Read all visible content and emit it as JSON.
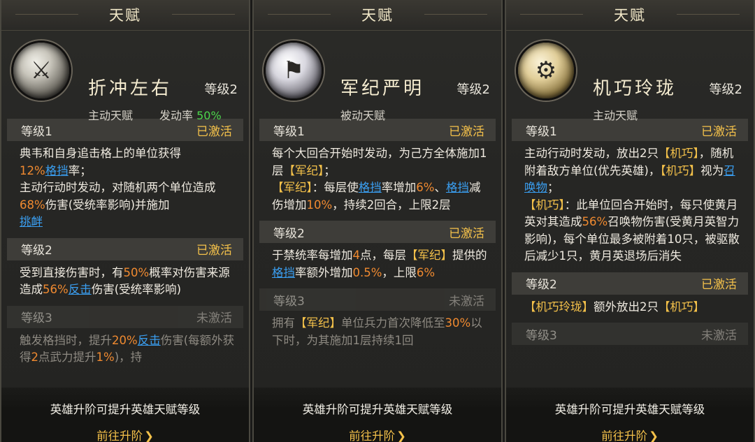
{
  "panels": [
    {
      "title": "天赋",
      "skill_name": "折冲左右",
      "level": "等级2",
      "skill_type": "主动天赋",
      "rate_label": "发动率",
      "rate_value": "50%",
      "icon": "crossed-weapons-icon",
      "sections": [
        {
          "name": "等级1",
          "status": "已激活"
        },
        {
          "name": "等级2",
          "status": "已激活"
        },
        {
          "name": "等级3",
          "status": "未激活"
        }
      ],
      "footer_hint": "英雄升阶可提升英雄天赋等级",
      "footer_link": "前往升阶"
    },
    {
      "title": "天赋",
      "skill_name": "军纪严明",
      "level": "等级2",
      "skill_type": "被动天赋",
      "icon": "flag-banner-icon",
      "sections": [
        {
          "name": "等级1",
          "status": "已激活"
        },
        {
          "name": "等级2",
          "status": "已激活"
        },
        {
          "name": "等级3",
          "status": "未激活"
        }
      ],
      "footer_hint": "英雄升阶可提升英雄天赋等级",
      "footer_link": "前往升阶"
    },
    {
      "title": "天赋",
      "skill_name": "机巧玲珑",
      "level": "等级2",
      "skill_type": "主动天赋",
      "icon": "gear-mechanism-icon",
      "sections": [
        {
          "name": "等级1",
          "status": "已激活"
        },
        {
          "name": "等级2",
          "status": "已激活"
        },
        {
          "name": "等级3",
          "status": "未激活"
        }
      ],
      "footer_hint": "英雄升阶可提升英雄天赋等级",
      "footer_link": "前往升阶"
    }
  ],
  "descriptions": {
    "p1_l1": [
      "典韦和自身追击格上的单位获得",
      "12%",
      "格挡",
      "率；",
      "主动行动时发动，对随机两个单位造成",
      "68%",
      "伤害(受统率影响)并施加",
      "挑衅"
    ],
    "p1_l2": [
      "受到直接伤害时，有",
      "50%",
      "概率对伤害来源造成",
      "56%",
      "反击",
      "伤害(受统率影响)"
    ],
    "p1_l3": [
      "触发格挡时，提升",
      "20%",
      "反击",
      "伤害(每额外获得",
      "2",
      "点武力提升",
      "1%",
      ")，持"
    ],
    "p2_l1": [
      "每个大回合开始时发动，为己方全体施加1层",
      "【军纪】",
      "；",
      "【军纪】",
      "：每层使",
      "格挡",
      "率增加",
      "6%",
      "、",
      "格挡",
      "减伤增加",
      "10%",
      "，持续2回合，上限2层"
    ],
    "p2_l2": [
      "于禁统率每增加",
      "4",
      "点，每层",
      "【军纪】",
      "提供的",
      "格挡",
      "率额外增加",
      "0.5%",
      "，上限",
      "6%"
    ],
    "p2_l3": [
      "拥有",
      "【军纪】",
      "单位兵力首次降低至",
      "30%",
      "以下时，为其施加1层持续1回"
    ],
    "p3_l1": [
      "主动行动时发动，放出2只",
      "【机巧】",
      "，随机附着敌方单位(优先英雄)，",
      "【机巧】",
      "视为",
      "召唤物",
      "；",
      "【机巧】",
      "：此单位回合开始时，每只使黄月英对其造成",
      "56%",
      "召唤物伤害(受黄月英智力影响)，每个单位最多被附着10只，被驱散后减少1只，黄月英退场后消失"
    ],
    "p3_l2": [
      "【机巧玲珑】",
      "额外放出2只",
      "【机巧】"
    ]
  }
}
